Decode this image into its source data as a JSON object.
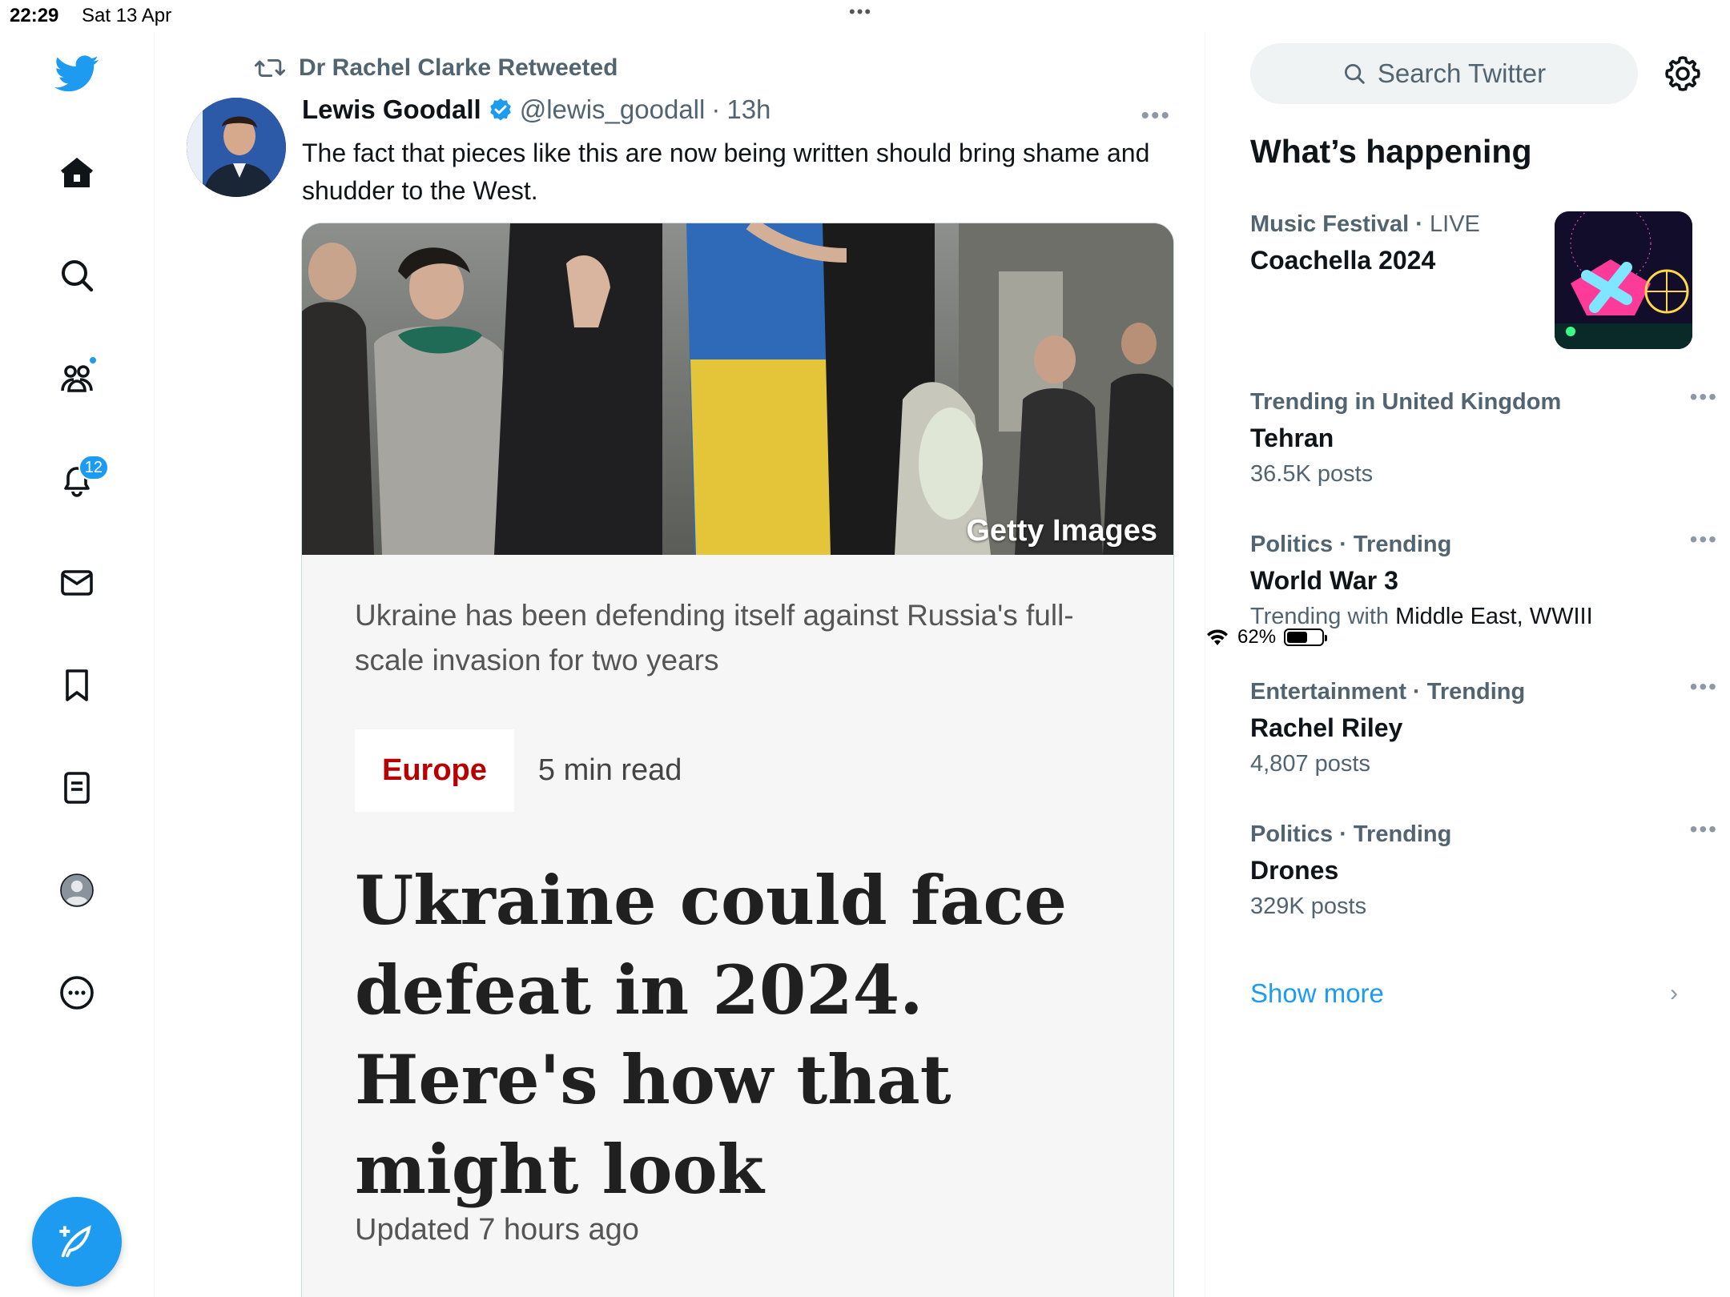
{
  "status_bar": {
    "time": "22:29",
    "date": "Sat 13 Apr",
    "battery": "62%",
    "battery_level": 0.62
  },
  "nav": {
    "notifications_badge": "12",
    "items": [
      "twitter-logo",
      "home",
      "explore",
      "communities",
      "notifications",
      "messages",
      "bookmarks",
      "lists",
      "profile",
      "more"
    ]
  },
  "tweet": {
    "retweeted_by": "Dr Rachel Clarke Retweeted",
    "author_name": "Lewis Goodall",
    "handle": "@lewis_goodall",
    "separator": "·",
    "time_ago": "13h",
    "text": "The fact that pieces like this are now being written should bring shame and shudder to the West.",
    "card": {
      "image_credit": "Getty Images",
      "image_caption": "Ukraine has been defending itself against Russia's full-scale invasion for two years",
      "section": "Europe",
      "read_time": "5 min read",
      "headline": "Ukraine could face defeat in 2024. Here's how that might look",
      "updated": "Updated 7 hours ago"
    }
  },
  "sidebar": {
    "search_placeholder": "Search Twitter",
    "heading": "What’s happening",
    "trends": [
      {
        "category": "Music Festival",
        "live": "LIVE",
        "title": "Coachella 2024"
      },
      {
        "category": "Trending in United Kingdom",
        "title": "Tehran",
        "sub": "36.5K posts"
      },
      {
        "category": "Politics · Trending",
        "title": "World War 3",
        "sub_prefix": "Trending with",
        "sub_strong": "Middle East, WWIII"
      },
      {
        "category": "Entertainment · Trending",
        "title": "Rachel Riley",
        "sub": "4,807 posts"
      },
      {
        "category": "Politics · Trending",
        "title": "Drones",
        "sub": "329K posts"
      }
    ],
    "show_more": "Show more"
  },
  "colors": {
    "accent": "#1d9bf0",
    "europe_red": "#b80000",
    "secondary_text": "#536471"
  }
}
